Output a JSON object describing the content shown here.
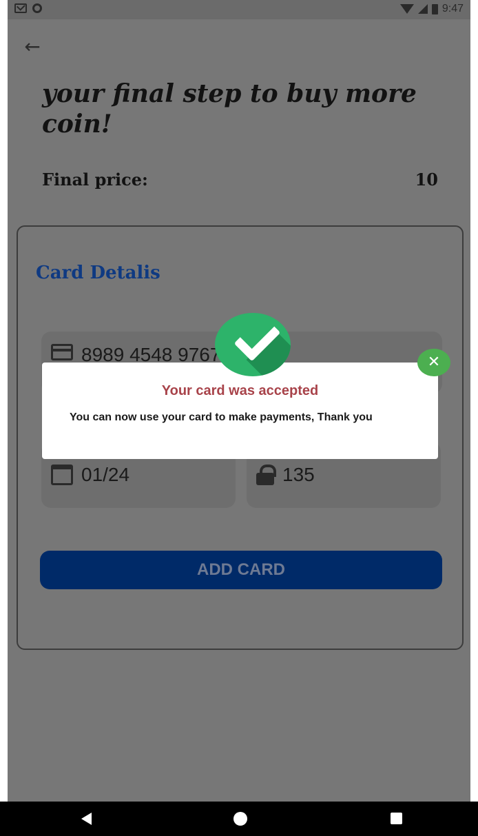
{
  "status_bar": {
    "time": "9:47"
  },
  "header": {
    "title": "your final step to buy more coin!"
  },
  "price": {
    "label": "Final price:",
    "value": "10"
  },
  "card_form": {
    "title": "Card Detalis",
    "card_number": "8989 4548 9767 3748",
    "expiry": "01/24",
    "cvv": "135",
    "add_button_label": "ADD CARD"
  },
  "dialog": {
    "title": "Your card was accepted",
    "message": "You can now use your card to make payments, Thank you"
  },
  "colors": {
    "accent": "#0f3a82",
    "button": "#002a68",
    "success": "#2db36a",
    "dialog_title": "#a8434a"
  },
  "icons": [
    "arrow-left-icon",
    "card-icon",
    "calendar-icon",
    "lock-icon",
    "check-icon",
    "close-icon"
  ]
}
